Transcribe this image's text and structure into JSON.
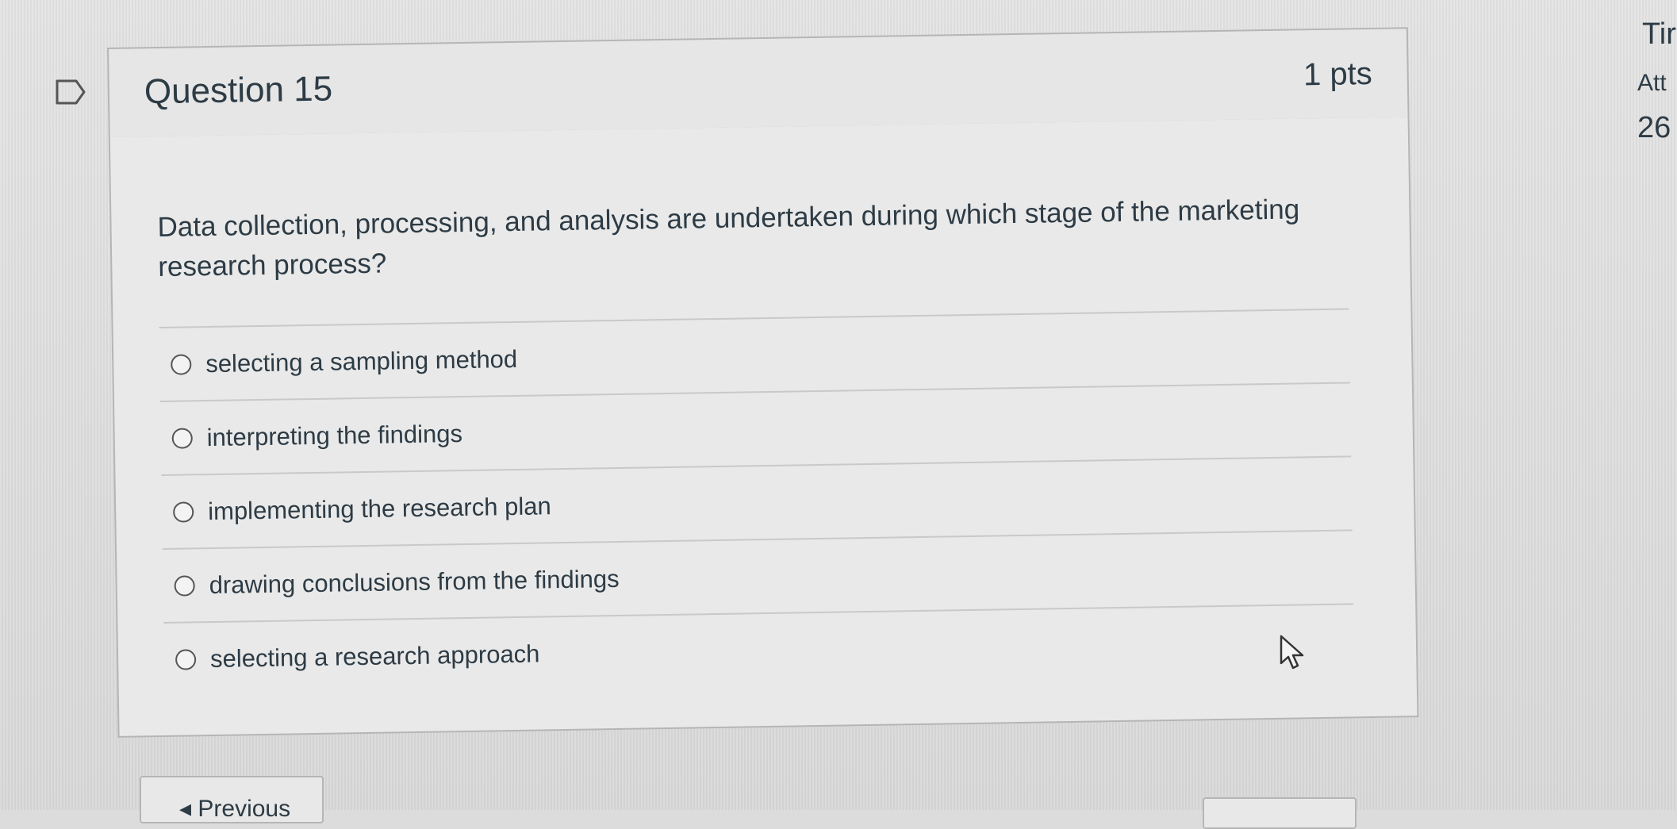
{
  "question": {
    "title": "Question 15",
    "points": "1 pts",
    "text": "Data collection, processing, and analysis are undertaken during which stage of the marketing research process?",
    "answers": [
      {
        "label": "selecting a sampling method"
      },
      {
        "label": "interpreting the findings"
      },
      {
        "label": "implementing the research plan"
      },
      {
        "label": "drawing conclusions from the findings"
      },
      {
        "label": "selecting a research approach"
      }
    ]
  },
  "navigation": {
    "previous_label": "◂ Previous"
  },
  "sidebar": {
    "time_label": "Tir",
    "attempt_label": "Att",
    "number_value": "26"
  },
  "icons": {
    "flag": "flag-question-icon",
    "cursor": "mouse-pointer-icon"
  },
  "colors": {
    "text": "#2d3b45",
    "border": "#b5b5b5",
    "header_bg": "#e6e6e6"
  }
}
